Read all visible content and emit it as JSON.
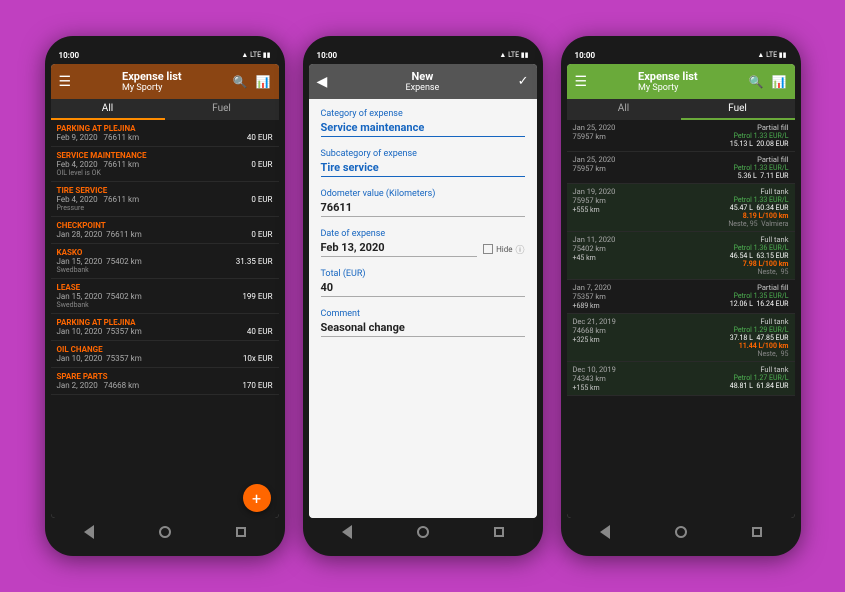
{
  "colors": {
    "bg": "#c040c0",
    "header1": "#8B4513",
    "header2": "#555555",
    "header3": "#6aaa3a",
    "orange": "#ff6600",
    "green": "#6aaa3a"
  },
  "phone1": {
    "status_time": "10:00",
    "header_title": "Expense list",
    "header_subtitle": "My Sporty",
    "tab_all": "All",
    "tab_fuel": "Fuel",
    "expenses": [
      {
        "category": "PARKING AT PLEJINA",
        "date_km": "Feb 9, 2020    76611 km",
        "amount": "40 EUR",
        "note": ""
      },
      {
        "category": "SERVICE MAINTENANCE",
        "date_km": "Feb 4, 2020    76611 km",
        "amount": "0 EUR",
        "note": "OIL level is OK"
      },
      {
        "category": "TIRE SERVICE",
        "date_km": "Feb 4, 2020    76611 km",
        "amount": "0 EUR",
        "note": "Pressure"
      },
      {
        "category": "CHECKPOINT",
        "date_km": "Jan 28, 2020   76611 km",
        "amount": "0 EUR",
        "note": ""
      },
      {
        "category": "KASKO",
        "date_km": "Jan 15, 2020   75402 km",
        "amount": "31.35 EUR",
        "note": "Swedbank"
      },
      {
        "category": "LEASE",
        "date_km": "Jan 15, 2020   75402 km",
        "amount": "199 EUR",
        "note": "Swedbank"
      },
      {
        "category": "PARKING AT PLEJINA",
        "date_km": "Jan 10, 2020   75357 km",
        "amount": "40 EUR",
        "note": ""
      },
      {
        "category": "OIL CHANGE",
        "date_km": "Jan 10, 2020   75357 km",
        "amount": "10x EUR",
        "note": ""
      },
      {
        "category": "SPARE PARTS",
        "date_km": "Jan 2, 2020    74668 km",
        "amount": "170 EUR",
        "note": ""
      }
    ]
  },
  "phone2": {
    "status_time": "10:00",
    "header_title": "New",
    "header_subtitle": "Expense",
    "label_category": "Category of expense",
    "value_category": "Service maintenance",
    "label_subcategory": "Subcategory of expense",
    "value_subcategory": "Tire service",
    "label_odometer": "Odometer value (Kilometers)",
    "value_odometer": "76611",
    "label_date": "Date of expense",
    "value_date": "Feb 13, 2020",
    "hide_label": "Hide",
    "label_total": "Total (EUR)",
    "value_total": "40",
    "label_comment": "Comment",
    "value_comment": "Seasonal change"
  },
  "phone3": {
    "status_time": "10:00",
    "header_title": "Expense list",
    "header_subtitle": "My Sporty",
    "tab_all": "All",
    "tab_fuel": "Fuel",
    "fuel_items": [
      {
        "date": "Jan 25, 2020",
        "km": "75957 km",
        "type": "Partial fill",
        "petrol": "Petrol 1.33 EUR/L",
        "liters": "15.13 L  20.08 EUR",
        "efficiency": "",
        "station": ""
      },
      {
        "date": "Jan 25, 2020",
        "km": "75957 km",
        "type": "Partial fill",
        "petrol": "Petrol 1.33 EUR/L",
        "liters": "5.36 L  7.11 EUR",
        "efficiency": "",
        "station": ""
      },
      {
        "date": "Jan 19, 2020",
        "km": "75957 km",
        "type": "Full tank",
        "petrol": "Petrol 1.33 EUR/L",
        "liters": "45.47 L  60.34 EUR",
        "efficiency": "8.19 L/100 km",
        "station": "Neste, 95  Valmiera"
      },
      {
        "date": "Jan 11, 2020",
        "km": "75402 km",
        "type": "Full tank",
        "petrol": "Petrol 1.36 EUR/L",
        "liters": "46.54 L  63.15 EUR",
        "efficiency": "7.98 L/100 km",
        "station": "Neste,  95"
      },
      {
        "date": "Jan 7, 2020",
        "km": "75357 km",
        "type": "Partial fill",
        "petrol": "Petrol 1.35 EUR/L",
        "liters": "12.06 L  16.24 EUR",
        "efficiency": "",
        "station": ""
      },
      {
        "date": "Dec 21, 2019",
        "km": "74668 km",
        "type": "Full tank",
        "petrol": "Petrol 1.29 EUR/L",
        "liters": "37.18 L  47.85 EUR",
        "efficiency": "11.44 L/100 km",
        "station": "Neste,  95"
      },
      {
        "date": "Dec 10, 2019",
        "km": "74343 km",
        "type": "Full tank",
        "petrol": "Petrol 1.27 EUR/L",
        "liters": "48.81 L  61.84 EUR",
        "efficiency": "",
        "station": ""
      }
    ]
  }
}
